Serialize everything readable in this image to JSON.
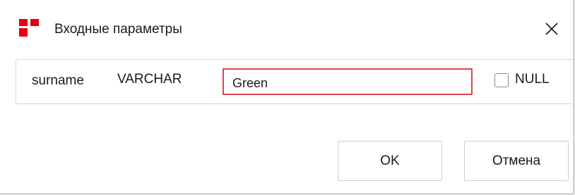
{
  "window": {
    "title": "Входные параметры",
    "logo_icon": "app-logo-icon",
    "close_icon": "close-icon",
    "accent_color": "#e3000f"
  },
  "parameter": {
    "name": "surname",
    "type": "VARCHAR",
    "value": "Green",
    "null_label": "NULL",
    "null_checked": false,
    "input_border_color": "#d9444b"
  },
  "buttons": {
    "ok_label": "OK",
    "cancel_label": "Отмена"
  }
}
